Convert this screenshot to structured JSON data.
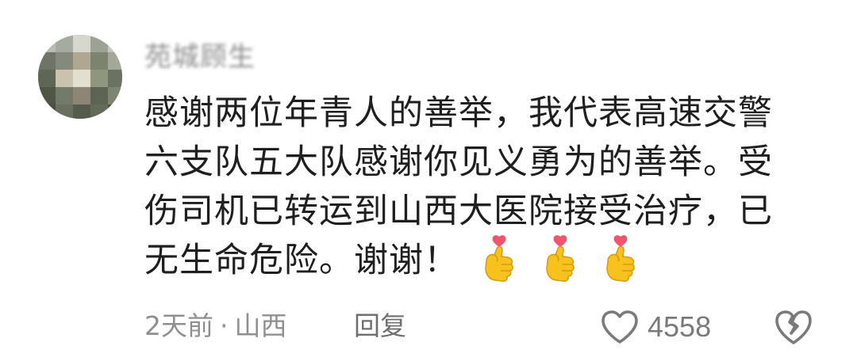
{
  "comment": {
    "username": "苑城顾生",
    "text_lines": [
      "感谢两位年青人的善举，我代表高速交警",
      "六支队五大队感谢你见义勇为的善举。受",
      "伤司机已转运到山西大医院接受治疗，已",
      "无生命危险。谢谢！"
    ],
    "emojis": [
      "finger-heart-emoji",
      "finger-heart-emoji",
      "finger-heart-emoji"
    ],
    "time": "2天前",
    "separator": "·",
    "location": "山西",
    "reply_label": "回复",
    "like_count": "4558"
  },
  "icons": {
    "like": "heart-outline-icon",
    "dislike": "broken-heart-icon"
  },
  "colors": {
    "text": "#1f1f1f",
    "meta": "#8f8f8f",
    "icon": "#7a7a7a",
    "emoji_hand": "#f7c11e",
    "emoji_heart": "#f0556d"
  }
}
